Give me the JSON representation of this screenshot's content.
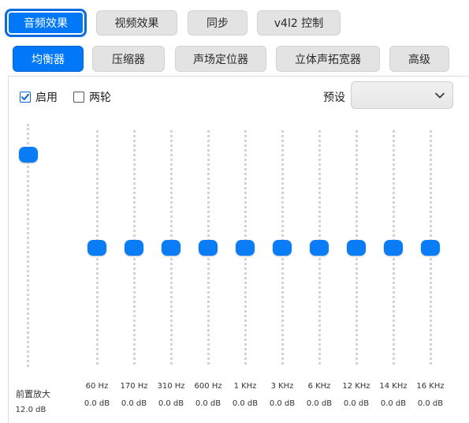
{
  "top_tabs": [
    "音频效果",
    "视频效果",
    "同步",
    "v4l2 控制"
  ],
  "sub_tabs": [
    "均衡器",
    "压缩器",
    "声场定位器",
    "立体声拓宽器",
    "高级"
  ],
  "options": {
    "enable_label": "启用",
    "enable_checked": true,
    "two_pass_label": "两轮",
    "two_pass_checked": false,
    "preset_label": "预设",
    "preset_value": ""
  },
  "preamp": {
    "label": "前置放大",
    "value_text": "12.0 dB",
    "level": 0.9
  },
  "bands": [
    {
      "freq": "60 Hz",
      "value": "0.0 dB",
      "level": 0.5
    },
    {
      "freq": "170 Hz",
      "value": "0.0 dB",
      "level": 0.5
    },
    {
      "freq": "310 Hz",
      "value": "0.0 dB",
      "level": 0.5
    },
    {
      "freq": "600 Hz",
      "value": "0.0 dB",
      "level": 0.5
    },
    {
      "freq": "1 KHz",
      "value": "0.0 dB",
      "level": 0.5
    },
    {
      "freq": "3 KHz",
      "value": "0.0 dB",
      "level": 0.5
    },
    {
      "freq": "6 KHz",
      "value": "0.0 dB",
      "level": 0.5
    },
    {
      "freq": "12 KHz",
      "value": "0.0 dB",
      "level": 0.5
    },
    {
      "freq": "14 KHz",
      "value": "0.0 dB",
      "level": 0.5
    },
    {
      "freq": "16 KHz",
      "value": "0.0 dB",
      "level": 0.5
    }
  ],
  "colors": {
    "accent": "#0a7cf5",
    "tab_inactive": "#e3e3e3"
  },
  "icons": {
    "check": "checkmark-icon",
    "dropdown": "chevron-down-icon"
  }
}
